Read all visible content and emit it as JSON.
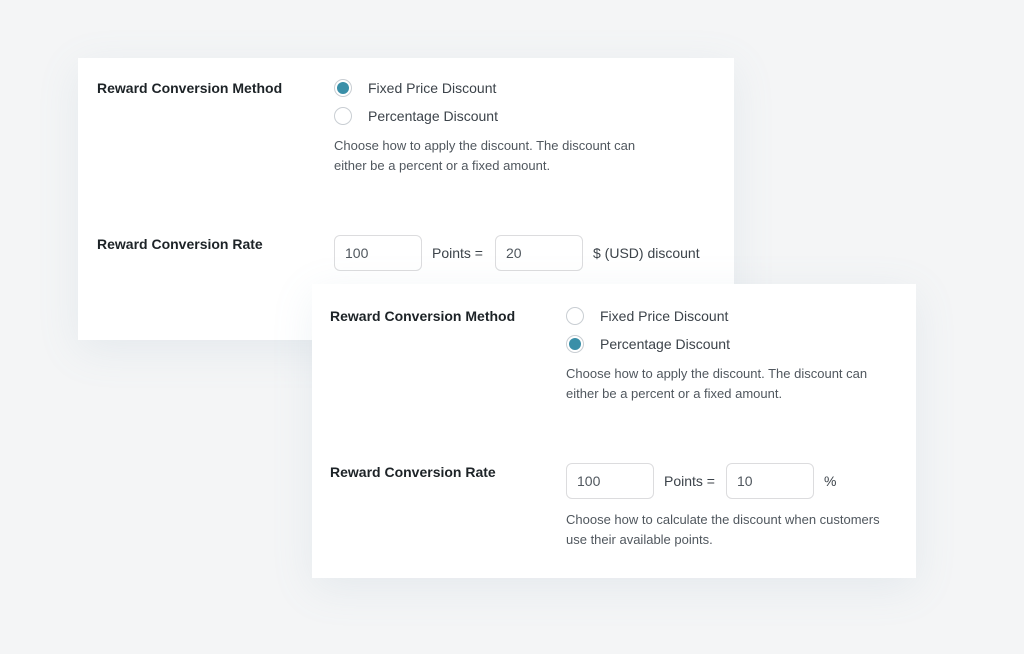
{
  "panel_a": {
    "method_label": "Reward Conversion Method",
    "options": [
      {
        "label": "Fixed Price Discount",
        "selected": true
      },
      {
        "label": "Percentage Discount",
        "selected": false
      }
    ],
    "method_description_line1": "Choose how to apply the discount. The discount can",
    "method_description_line2": "either be a percent or a fixed amount.",
    "rate_label": "Reward Conversion Rate",
    "points_value": "100",
    "points_text": "Points =",
    "discount_value": "20",
    "unit_text": "$ (USD) discount"
  },
  "panel_b": {
    "method_label": "Reward Conversion Method",
    "options": [
      {
        "label": "Fixed Price Discount",
        "selected": false
      },
      {
        "label": "Percentage Discount",
        "selected": true
      }
    ],
    "method_description_line1": "Choose how to apply the discount. The discount can",
    "method_description_line2": "either be a percent or a fixed amount.",
    "rate_label": "Reward Conversion Rate",
    "points_value": "100",
    "points_text": "Points =",
    "discount_value": "10",
    "unit_text": "%",
    "rate_description_line1": "Choose how to calculate the discount when customers",
    "rate_description_line2": "use their available points."
  },
  "colors": {
    "accent": "#3a8fa8",
    "background": "#f4f5f6",
    "panel": "#ffffff"
  }
}
